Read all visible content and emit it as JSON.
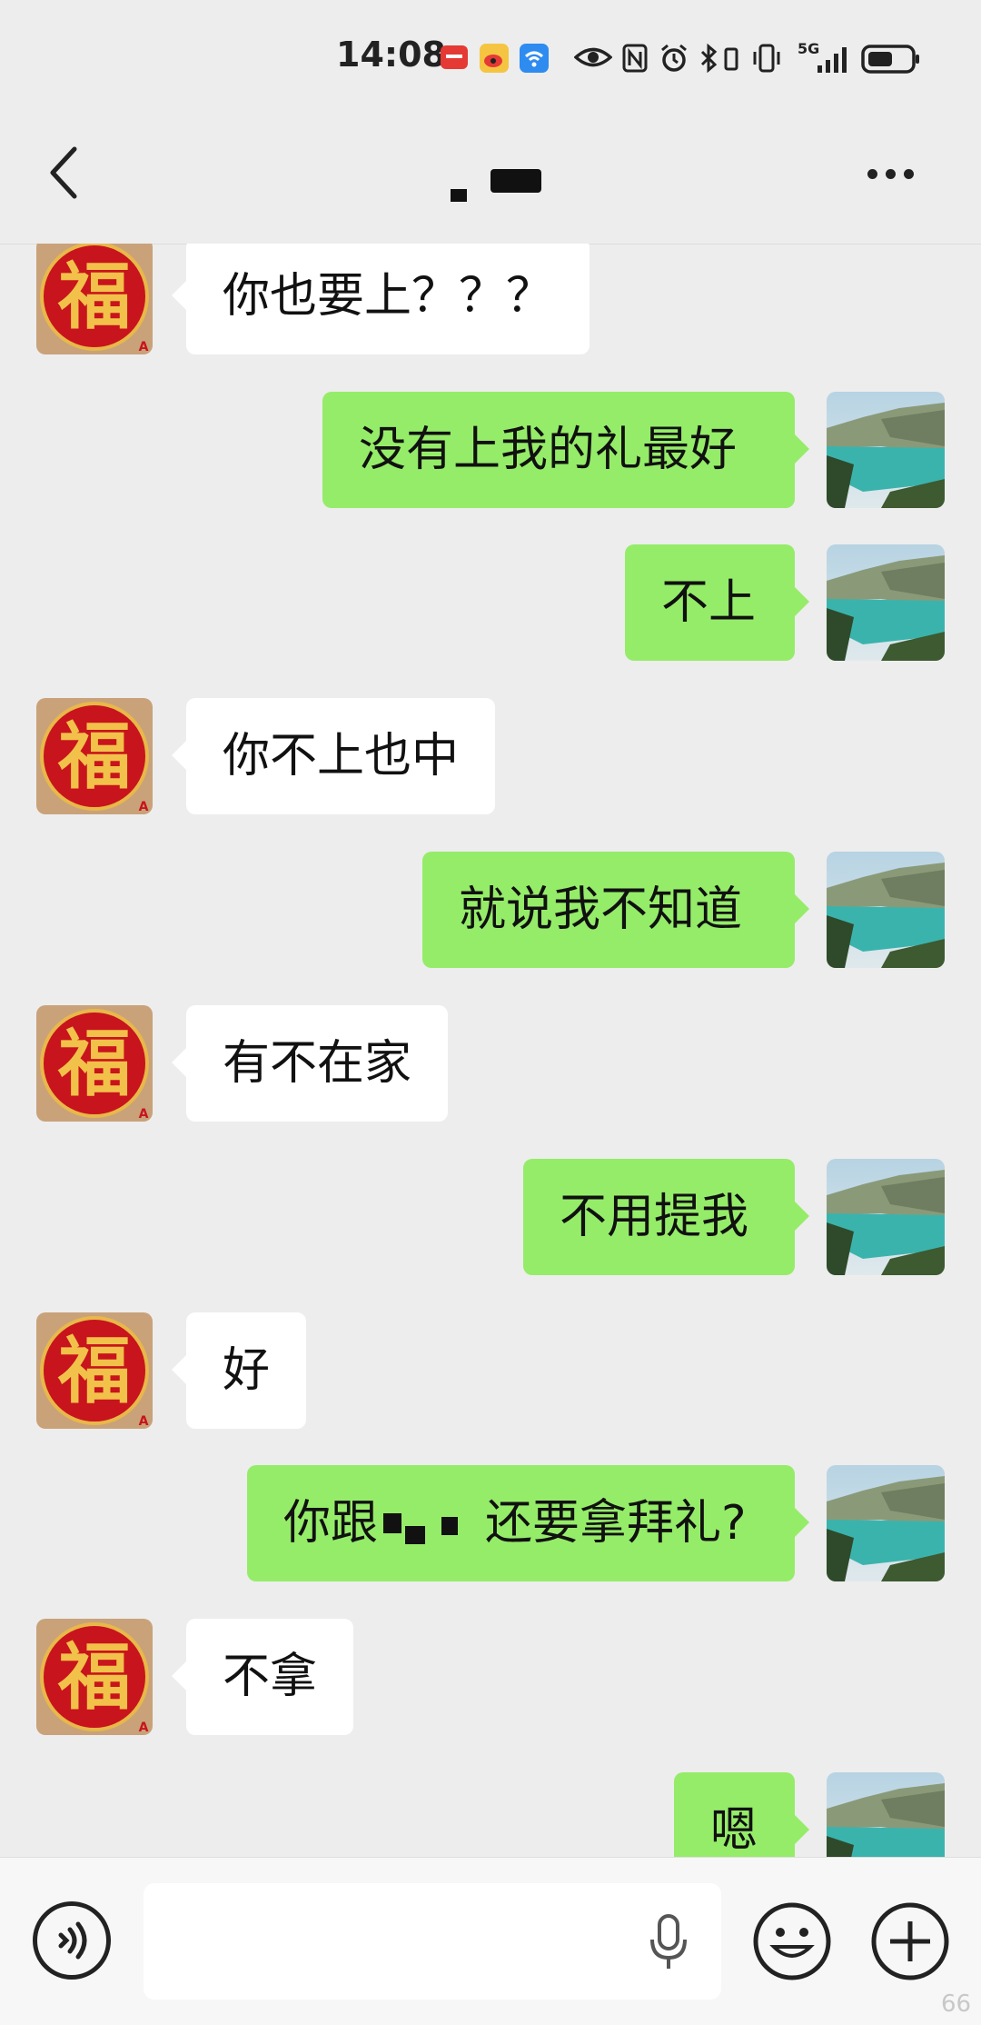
{
  "status_bar": {
    "time": "14:08",
    "network": "5G",
    "icons": [
      "huawei-mail-icon",
      "weibo-icon",
      "wifi-app-icon",
      "eye-icon",
      "nfc-icon",
      "alarm-icon",
      "bluetooth-icon",
      "vibrate-icon",
      "signal-icon",
      "battery-icon"
    ]
  },
  "header": {
    "back_icon": "chevron-left-icon",
    "title": "",
    "more_icon": "more-dots-icon"
  },
  "colors": {
    "background": "#ededed",
    "sent_bubble": "#95ec69",
    "received_bubble": "#ffffff"
  },
  "messages": [
    {
      "side": "left",
      "text": "你也要上？？？"
    },
    {
      "side": "right",
      "text": "没有上我的礼最好"
    },
    {
      "side": "right",
      "text": "不上"
    },
    {
      "side": "left",
      "text": "你不上也中"
    },
    {
      "side": "right",
      "text": "就说我不知道"
    },
    {
      "side": "left",
      "text": "有不在家"
    },
    {
      "side": "right",
      "text": "不用提我"
    },
    {
      "side": "left",
      "text": "好"
    },
    {
      "side": "right",
      "text_before": "你跟",
      "text_after": "还要拿拜礼?"
    },
    {
      "side": "left",
      "text": "不拿"
    },
    {
      "side": "right",
      "text": "嗯"
    }
  ],
  "input_bar": {
    "voice_icon": "voice-input-icon",
    "mic_icon": "microphone-icon",
    "emoji_icon": "emoji-icon",
    "plus_icon": "plus-icon"
  },
  "watermark": "66"
}
